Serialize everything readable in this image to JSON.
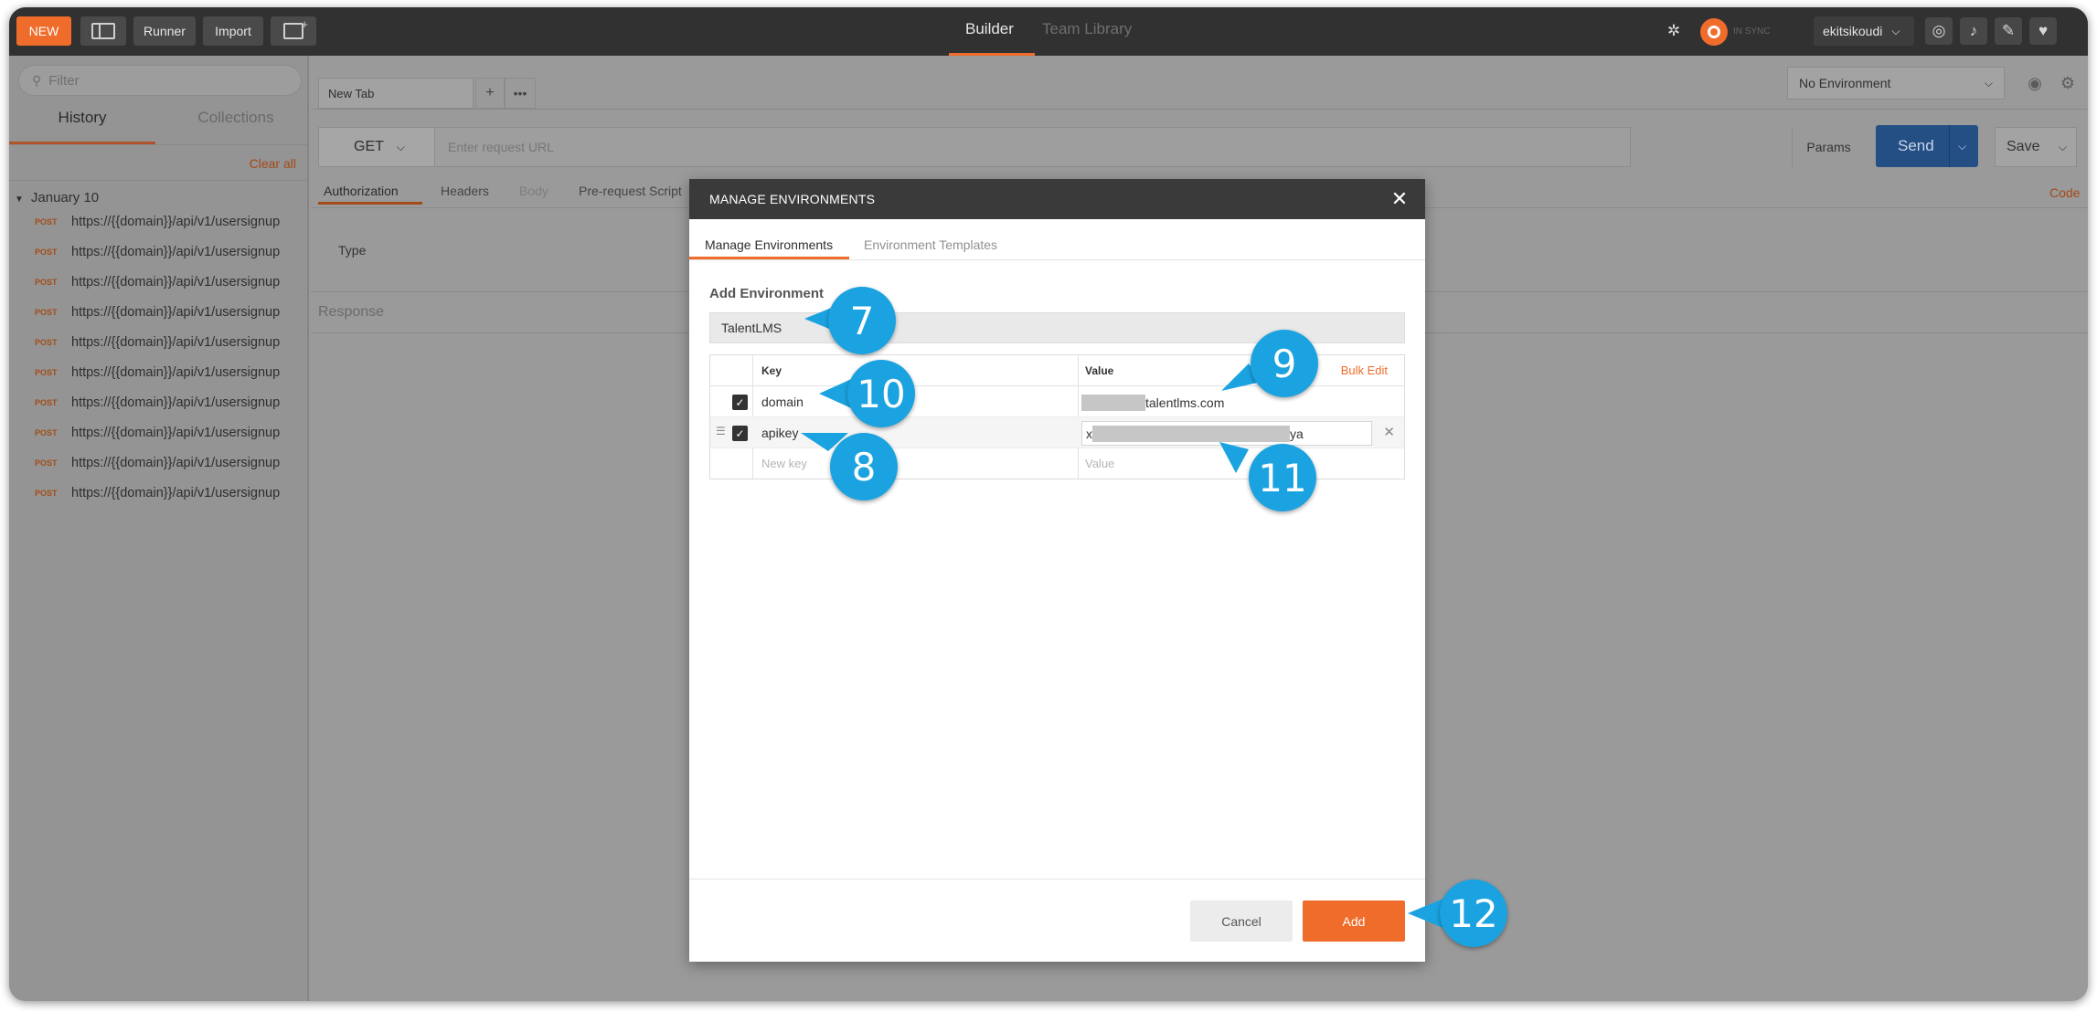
{
  "topbar": {
    "new_label": "NEW",
    "runner_label": "Runner",
    "import_label": "Import",
    "nav_builder": "Builder",
    "nav_team_library": "Team Library",
    "sync_status": "IN SYNC",
    "username": "ekitsikoudi"
  },
  "sidebar": {
    "filter_placeholder": "Filter",
    "tab_history": "History",
    "tab_collections": "Collections",
    "clear_all": "Clear all",
    "group_label": "January 10",
    "history_items": [
      {
        "method": "POST",
        "url": "https://{{domain}}/api/v1/usersignup"
      },
      {
        "method": "POST",
        "url": "https://{{domain}}/api/v1/usersignup"
      },
      {
        "method": "POST",
        "url": "https://{{domain}}/api/v1/usersignup"
      },
      {
        "method": "POST",
        "url": "https://{{domain}}/api/v1/usersignup"
      },
      {
        "method": "POST",
        "url": "https://{{domain}}/api/v1/usersignup"
      },
      {
        "method": "POST",
        "url": "https://{{domain}}/api/v1/usersignup"
      },
      {
        "method": "POST",
        "url": "https://{{domain}}/api/v1/usersignup"
      },
      {
        "method": "POST",
        "url": "https://{{domain}}/api/v1/usersignup"
      },
      {
        "method": "POST",
        "url": "https://{{domain}}/api/v1/usersignup"
      },
      {
        "method": "POST",
        "url": "https://{{domain}}/api/v1/usersignup"
      }
    ]
  },
  "main": {
    "tab_label": "New Tab",
    "tab_add": "+",
    "tab_more": "•••",
    "environment_select": "No Environment",
    "method": "GET",
    "url_placeholder": "Enter request URL",
    "params_label": "Params",
    "send_label": "Send",
    "save_label": "Save",
    "subtabs": [
      "Authorization",
      "Headers",
      "Body",
      "Pre-request Script"
    ],
    "code_link": "Code",
    "type_label": "Type",
    "response_label": "Response"
  },
  "modal": {
    "title": "MANAGE ENVIRONMENTS",
    "tab_manage": "Manage Environments",
    "tab_templates": "Environment Templates",
    "add_env_label": "Add Environment",
    "env_name_value": "TalentLMS",
    "col_key": "Key",
    "col_value": "Value",
    "bulk_edit": "Bulk Edit",
    "rows": [
      {
        "key": "domain",
        "value_suffix": "talentlms.com",
        "enabled": true
      },
      {
        "key": "apikey",
        "value_prefix": "x",
        "value_suffix": "ya",
        "enabled": true
      }
    ],
    "new_key_placeholder": "New key",
    "new_value_placeholder": "Value",
    "cancel_label": "Cancel",
    "add_label": "Add"
  },
  "callouts": [
    "7",
    "8",
    "9",
    "10",
    "11",
    "12"
  ],
  "colors": {
    "accent_orange": "#ef6c2b",
    "callout_blue": "#1aa3e0",
    "send_blue": "#234f85",
    "topbar_dark": "#313131"
  }
}
